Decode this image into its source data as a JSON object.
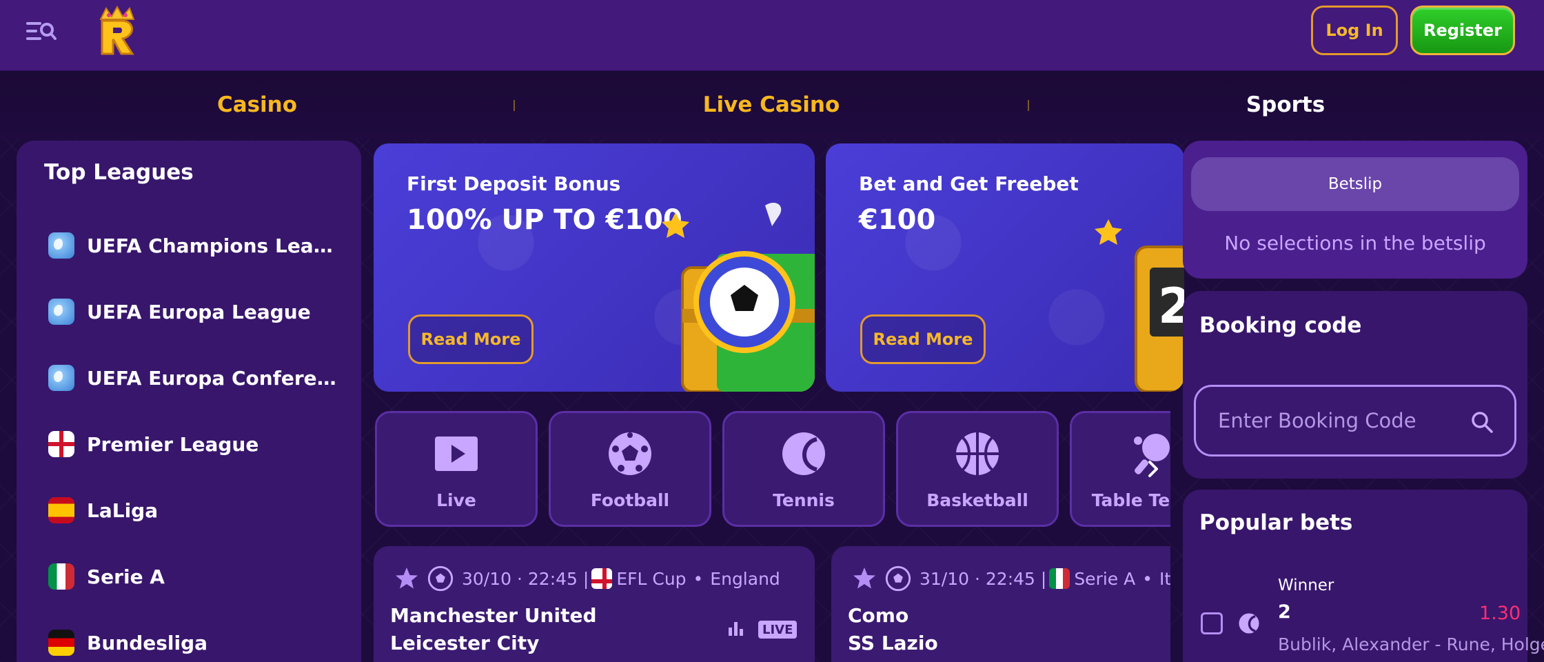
{
  "header": {
    "login_label": "Log In",
    "register_label": "Register"
  },
  "topnav": {
    "items": [
      {
        "label": "Casino"
      },
      {
        "label": "Live Casino"
      },
      {
        "label": "Sports"
      }
    ]
  },
  "sidebar": {
    "title": "Top Leagues",
    "leagues": [
      {
        "label": "UEFA Champions League",
        "icon": "globe-icon"
      },
      {
        "label": "UEFA Europa League",
        "icon": "globe-icon"
      },
      {
        "label": "UEFA Europa Conference League",
        "icon": "globe-icon"
      },
      {
        "label": "Premier League",
        "icon": "england-flag-icon"
      },
      {
        "label": "LaLiga",
        "icon": "spain-flag-icon"
      },
      {
        "label": "Serie A",
        "icon": "italy-flag-icon"
      },
      {
        "label": "Bundesliga",
        "icon": "germany-flag-icon"
      }
    ]
  },
  "promos": [
    {
      "title": "First Deposit Bonus",
      "amount": "100% UP TO €100",
      "button": "Read More"
    },
    {
      "title": "Bet and Get Freebet",
      "amount": "€100",
      "button": "Read More"
    }
  ],
  "categories": [
    {
      "label": "Live",
      "icon": "live-play-icon"
    },
    {
      "label": "Football",
      "icon": "football-icon"
    },
    {
      "label": "Tennis",
      "icon": "tennis-icon"
    },
    {
      "label": "Basketball",
      "icon": "basketball-icon"
    },
    {
      "label": "Table Tennis",
      "icon": "table-tennis-icon"
    }
  ],
  "matches": [
    {
      "datetime": "30/10 · 22:45 |",
      "competition": "EFL Cup",
      "country": "England",
      "home": "Manchester United",
      "away": "Leicester City",
      "live_badge": "LIVE"
    },
    {
      "datetime": "31/10 · 22:45 |",
      "competition": "Serie A",
      "country": "Italy",
      "home": "Como",
      "away": "SS Lazio"
    }
  ],
  "betslip": {
    "tab_label": "Betslip",
    "empty_text": "No selections in the betslip"
  },
  "booking": {
    "title": "Booking code",
    "placeholder": "Enter Booking Code"
  },
  "popular": {
    "title": "Popular bets",
    "bet": {
      "market": "Winner",
      "selection": "2",
      "odds": "1.30",
      "event": "Bublik, Alexander - Rune, Holger"
    }
  },
  "colors": {
    "header_bg": "#43197c",
    "accent_gold": "#f7b81f",
    "register_green": "#2fcf2a",
    "panel_bg": "#38166c",
    "odds_red": "#ff2f73"
  }
}
